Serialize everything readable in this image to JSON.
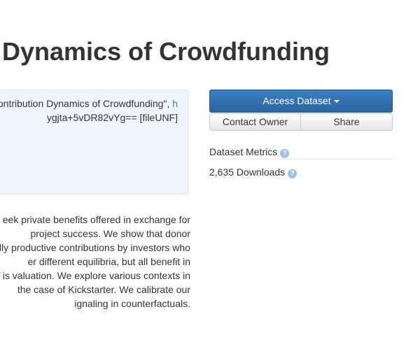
{
  "page": {
    "title": "Dynamics of Crowdfunding"
  },
  "citation": {
    "line1_text": "ontribution Dynamics of Crowdfunding\", ",
    "line1_link": "h",
    "line2_text": "ygjta+5vDR82vYg== [fileUNF]"
  },
  "description": {
    "lines": [
      "eek private benefits offered in exchange for",
      "project success. We show that donor",
      "lly productive contributions by investors who",
      "er different equilibria, but all benefit in",
      "is valuation. We explore various contexts in",
      " the case of Kickstarter. We calibrate our",
      "ignaling in counterfactuals."
    ]
  },
  "actions": {
    "access_label": "Access Dataset",
    "contact_label": "Contact Owner",
    "share_label": "Share"
  },
  "metrics": {
    "title": "Dataset Metrics",
    "downloads": "2,635 Downloads",
    "help_glyph": "?"
  },
  "icons": {
    "caret": "caret-down-icon",
    "help": "question-circle-icon"
  },
  "colors": {
    "primary": "#337ab7",
    "citation_bg": "#eef5fc",
    "help_icon": "#9ec0e0"
  }
}
